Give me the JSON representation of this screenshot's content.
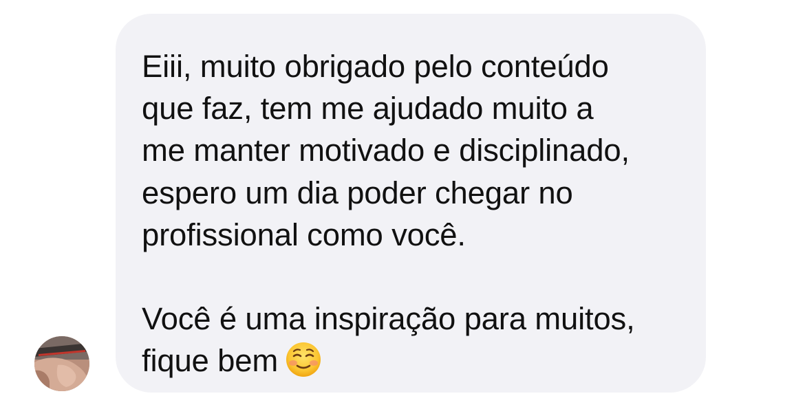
{
  "message": {
    "paragraph_1": "Eiii, muito obrigado pelo conteúdo\nque faz, tem me ajudado muito a\nme manter motivado e disciplinado,\nespero um dia poder chegar no\nprofissional como você.",
    "paragraph_2_line_1": "Você é uma inspiração para muitos,",
    "paragraph_2_line_2": "fique bem",
    "emoji": "smiling-face-icon"
  },
  "sender": {
    "avatar": "avatar-photo"
  },
  "colors": {
    "bubble": "#f2f2f6",
    "text": "#111111",
    "background": "#ffffff"
  }
}
